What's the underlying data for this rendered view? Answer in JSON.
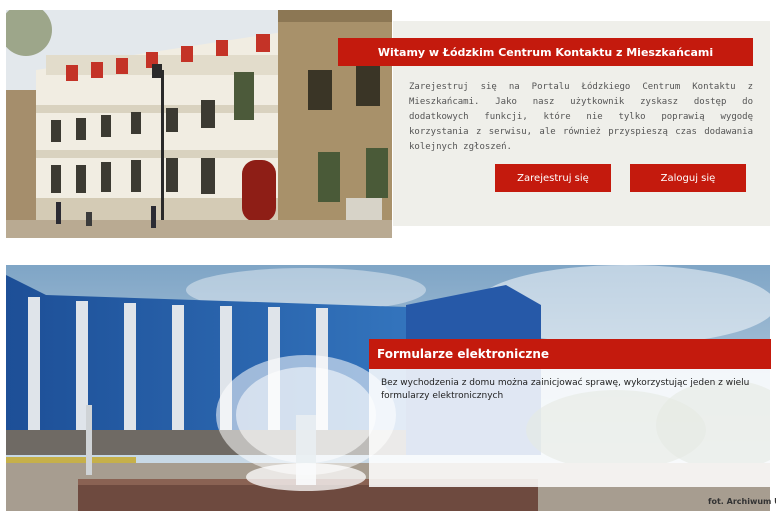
{
  "welcome": {
    "title": "Witamy w Łódzkim Centrum Kontaktu z Mieszkańcami",
    "text": "Zarejestruj się na Portalu Łódzkiego Centrum Kontaktu z Mieszkańcami. Jako nasz użytkownik zyskasz dostęp do dodatkowych funkcji, które nie tylko poprawią wygodę korzystania z serwisu, ale również przyspieszą czas dodawania kolejnych zgłoszeń.",
    "register_label": "Zarejestruj się",
    "login_label": "Zaloguj się"
  },
  "forms": {
    "title": "Formularze elektroniczne",
    "text": "Bez wychodzenia z domu można zainicjować sprawę, wykorzystując jeden z wielu formularzy elektronicznych"
  },
  "photo_credit": "fot. Archiwum U",
  "colors": {
    "accent": "#c41a0d",
    "panel_bg": "#efefea",
    "text": "#555555"
  }
}
